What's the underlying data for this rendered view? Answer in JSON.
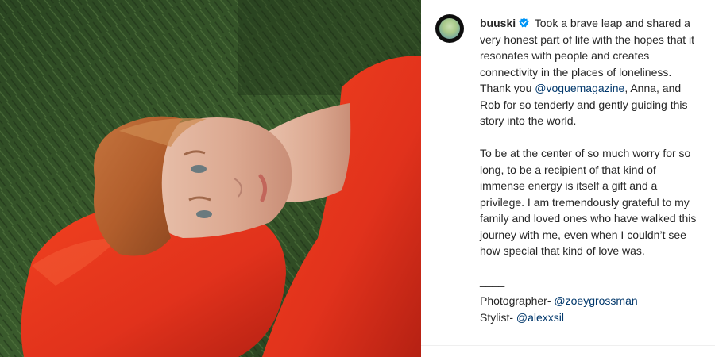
{
  "post": {
    "author": {
      "username": "buuski",
      "verified": true,
      "verified_color": "#0095f6"
    },
    "caption": {
      "intro": "Took a brave leap and shared a very honest part of life with the hopes that it resonates with people and creates connectivity in the places of loneliness. Thank you",
      "mention_1": "@voguemagazine",
      "intro_tail": ", Anna, and Rob for so tenderly and gently guiding this story into the world.",
      "paragraph_2": "To be at the center of so much worry for so long, to be a recipient of that kind of immense energy is itself a gift and a privilege. I am tremendously grateful to my family and loved ones who have walked this journey with me, even when I couldn’t see how special that kind of love was.",
      "divider": "____",
      "credit_1_label": "Photographer-",
      "credit_1_handle": "@zoeygrossman",
      "credit_2_label": "Stylist-",
      "credit_2_handle": "@alexxsil"
    },
    "colors": {
      "text": "#262626",
      "link": "#00376b",
      "sweater": "#e8321f",
      "grass": "#2f4d25"
    }
  }
}
